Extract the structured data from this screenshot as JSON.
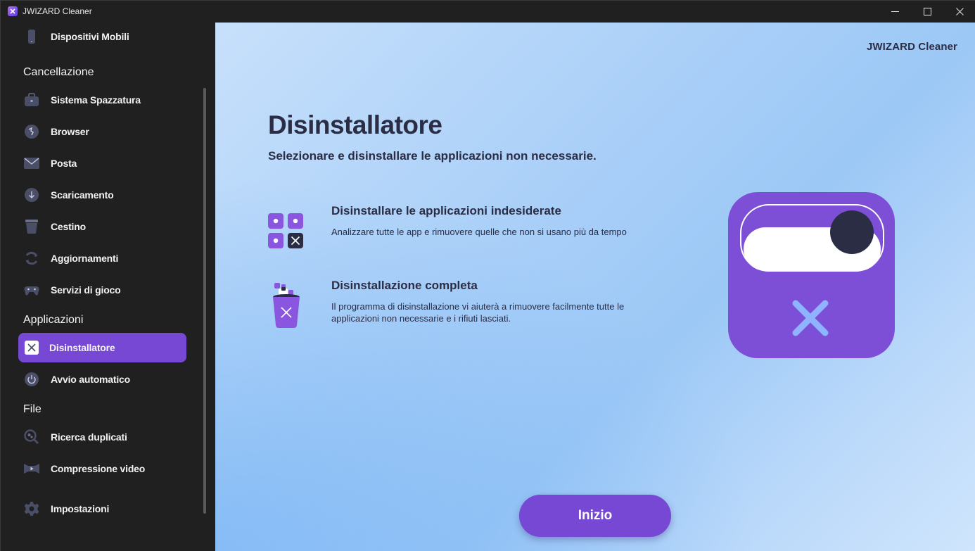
{
  "window": {
    "title": "JWIZARD Cleaner"
  },
  "sidebar": {
    "top_item": {
      "label": "Dispositivi Mobili",
      "icon": "phone-icon"
    },
    "sections": {
      "cleaning": "Cancellazione",
      "applications": "Applicazioni",
      "file": "File"
    },
    "cleaning_items": [
      {
        "label": "Sistema Spazzatura",
        "icon": "briefcase-icon"
      },
      {
        "label": "Browser",
        "icon": "globe-icon"
      },
      {
        "label": "Posta",
        "icon": "mail-icon"
      },
      {
        "label": "Scaricamento",
        "icon": "download-icon"
      },
      {
        "label": "Cestino",
        "icon": "trash-icon"
      },
      {
        "label": "Aggiornamenti",
        "icon": "refresh-icon"
      },
      {
        "label": "Servizi di gioco",
        "icon": "gamepad-icon"
      }
    ],
    "application_items": [
      {
        "label": "Disinstallatore",
        "icon": "uninstall-icon",
        "active": true
      },
      {
        "label": "Avvio automatico",
        "icon": "power-icon"
      }
    ],
    "file_items": [
      {
        "label": "Ricerca duplicati",
        "icon": "search-duplicates-icon"
      },
      {
        "label": "Compressione video",
        "icon": "video-icon"
      }
    ],
    "settings": {
      "label": "Impostazioni",
      "icon": "gear-icon"
    }
  },
  "main": {
    "brand": "JWIZARD Cleaner",
    "title": "Disinstallatore",
    "subtitle": "Selezionare e disinstallare le applicazioni non necessarie.",
    "features": [
      {
        "title": "Disinstallare le applicazioni indesiderate",
        "description": "Analizzare tutte le app e rimuovere quelle che non si usano più da tempo",
        "icon": "app-grid-remove-icon"
      },
      {
        "title": "Disinstallazione completa",
        "description": "Il programma di disinstallazione vi aiuterà a rimuovere facilmente tutte le applicazioni non necessarie e i rifiuti lasciati.",
        "icon": "trash-bin-icon"
      }
    ],
    "start_button": "Inizio"
  },
  "colors": {
    "accent": "#7748d3",
    "sidebar_bg": "#202020",
    "text_dark": "#2b2d45"
  }
}
